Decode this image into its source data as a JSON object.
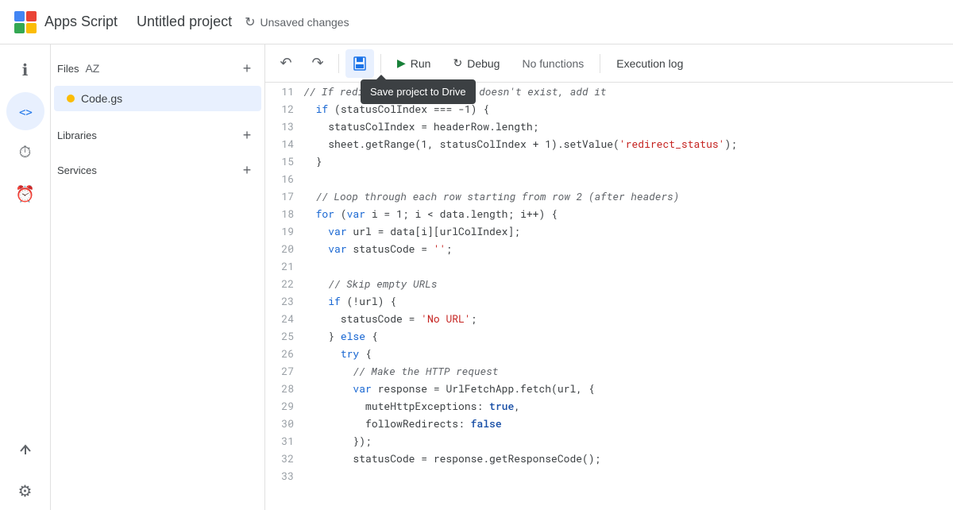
{
  "header": {
    "app_name": "Apps Script",
    "project_title": "Untitled project",
    "unsaved_label": "Unsaved changes"
  },
  "sidebar": {
    "icons": [
      {
        "name": "overview-icon",
        "symbol": "ℹ",
        "active": false
      },
      {
        "name": "code-icon",
        "symbol": "<>",
        "active": true
      },
      {
        "name": "history-icon",
        "symbol": "⏱",
        "active": false
      },
      {
        "name": "triggers-icon",
        "symbol": "⏰",
        "active": false
      },
      {
        "name": "deploy-icon",
        "symbol": "⇒",
        "active": false
      },
      {
        "name": "settings-icon",
        "symbol": "⚙",
        "active": false
      }
    ]
  },
  "file_panel": {
    "files_label": "Files",
    "files": [
      {
        "name": "Code.gs",
        "dot_color": "#fbbc04",
        "active": true
      }
    ],
    "libraries_label": "Libraries",
    "services_label": "Services"
  },
  "toolbar": {
    "undo_label": "↶",
    "redo_label": "↷",
    "save_label": "Save project to Drive",
    "run_label": "Run",
    "debug_label": "Debug",
    "no_functions_label": "No functions",
    "exec_log_label": "Execution log"
  },
  "tooltip": {
    "text": "Save project to Drive"
  },
  "code_lines": [
    {
      "num": 11,
      "code": "  <span class='comment'>// If redirect_status column doesn't exist, add it</span>"
    },
    {
      "num": 12,
      "code": "  <span class='kw'>if</span> (statusColIndex === -1) {"
    },
    {
      "num": 13,
      "code": "    statusColIndex = headerRow.length;"
    },
    {
      "num": 14,
      "code": "    sheet.getRange(1, statusColIndex + 1).setValue(<span class='str'>'redirect_status'</span>);"
    },
    {
      "num": 15,
      "code": "  }"
    },
    {
      "num": 16,
      "code": ""
    },
    {
      "num": 17,
      "code": "  <span class='comment'>// Loop through each row starting from row 2 (after headers)</span>"
    },
    {
      "num": 18,
      "code": "  <span class='kw'>for</span> (<span class='kw'>var</span> i = 1; i &lt; data.length; i++) {"
    },
    {
      "num": 19,
      "code": "    <span class='kw'>var</span> url = data[i][urlColIndex];"
    },
    {
      "num": 20,
      "code": "    <span class='kw'>var</span> statusCode = <span class='str'>''</span>;"
    },
    {
      "num": 21,
      "code": ""
    },
    {
      "num": 22,
      "code": "    <span class='comment'>// Skip empty URLs</span>"
    },
    {
      "num": 23,
      "code": "    <span class='kw'>if</span> (!url) {"
    },
    {
      "num": 24,
      "code": "      statusCode = <span class='str'>'No URL'</span>;"
    },
    {
      "num": 25,
      "code": "    } <span class='kw'>else</span> {"
    },
    {
      "num": 26,
      "code": "      <span class='kw'>try</span> {"
    },
    {
      "num": 27,
      "code": "        <span class='comment'>// Make the HTTP request</span>"
    },
    {
      "num": 28,
      "code": "        <span class='kw'>var</span> response = UrlFetchApp.fetch(url, {"
    },
    {
      "num": 29,
      "code": "          muteHttpExceptions: <span class='kw2'>true</span>,"
    },
    {
      "num": 30,
      "code": "          followRedirects: <span class='kw2'>false</span>"
    },
    {
      "num": 31,
      "code": "        });"
    },
    {
      "num": 32,
      "code": "        statusCode = response.getResponseCode();"
    },
    {
      "num": 33,
      "code": ""
    }
  ]
}
